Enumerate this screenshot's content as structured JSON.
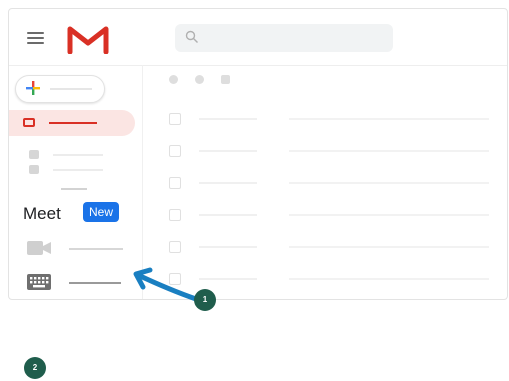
{
  "app": {
    "icons": {
      "menu": "hamburger-menu-icon",
      "logo": "gmail-logo-icon",
      "search": "search-icon"
    }
  },
  "sidebar": {
    "compose_icon": "plus-icon",
    "inbox_icon": "inbox-icon",
    "meet": {
      "title": "Meet",
      "badge": "New",
      "items": [
        {
          "icon": "video-camera-icon",
          "label": ""
        },
        {
          "icon": "keyboard-icon",
          "label": ""
        }
      ]
    }
  },
  "colors": {
    "brand_red": "#d93025",
    "badge_blue": "#1a73e8",
    "annotation_arrow": "#1a7fc1",
    "annotation_marker": "#1f5d4c"
  },
  "annotations": {
    "step1": {
      "label": "1"
    },
    "step2": {
      "label": "2"
    }
  }
}
